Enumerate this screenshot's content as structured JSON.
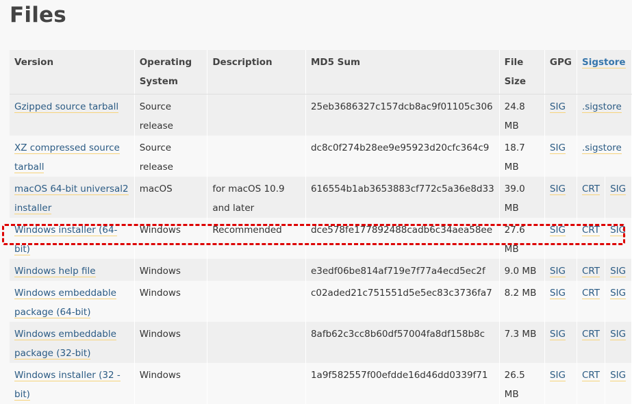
{
  "page": {
    "title": "Files"
  },
  "table": {
    "headers": {
      "version": "Version",
      "os": "Operating System",
      "description": "Description",
      "md5": "MD5 Sum",
      "size": "File Size",
      "gpg": "GPG",
      "sigstore": "Sigstore"
    },
    "rows": [
      {
        "version": "Gzipped source tarball",
        "os": "Source release",
        "description": "",
        "md5": "25eb3686327c157dcb8ac9f01105c306",
        "size": "24.8 MB",
        "gpg": "SIG",
        "sigstore": ".sigstore",
        "sig2": ""
      },
      {
        "version": "XZ compressed source tarball",
        "os": "Source release",
        "description": "",
        "md5": "dc8c0f274b28ee9e95923d20cfc364c9",
        "size": "18.7 MB",
        "gpg": "SIG",
        "sigstore": ".sigstore",
        "sig2": ""
      },
      {
        "version": "macOS 64-bit universal2 installer",
        "os": "macOS",
        "description": "for macOS 10.9 and later",
        "md5": "616554b1ab3653883cf772c5a36e8d33",
        "size": "39.0 MB",
        "gpg": "SIG",
        "sigstore": "CRT",
        "sig2": "SIG"
      },
      {
        "version": "Windows installer (64-bit)",
        "os": "Windows",
        "description": "Recommended",
        "md5": "dce578fe177892488cadb6c34aea58ee",
        "size": "27.6 MB",
        "gpg": "SIG",
        "sigstore": "CRT",
        "sig2": "SIG"
      },
      {
        "version": "Windows help file",
        "os": "Windows",
        "description": "",
        "md5": "e3edf06be814af719e7f77a4ecd5ec2f",
        "size": "9.0 MB",
        "gpg": "SIG",
        "sigstore": "CRT",
        "sig2": "SIG"
      },
      {
        "version": "Windows embeddable package (64-bit)",
        "os": "Windows",
        "description": "",
        "md5": "c02aded21c751551d5e5ec83c3736fa7",
        "size": "8.2 MB",
        "gpg": "SIG",
        "sigstore": "CRT",
        "sig2": "SIG"
      },
      {
        "version": "Windows embeddable package (32-bit)",
        "os": "Windows",
        "description": "",
        "md5": "8afb62c3cc8b60df57004fa8df158b8c",
        "size": "7.3 MB",
        "gpg": "SIG",
        "sigstore": "CRT",
        "sig2": "SIG"
      },
      {
        "version": "Windows installer (32 -bit)",
        "os": "Windows",
        "description": "",
        "md5": "1a9f582557f00efdde16d46dd0339f71",
        "size": "26.5 MB",
        "gpg": "SIG",
        "sigstore": "CRT",
        "sig2": "SIG"
      }
    ]
  },
  "colors": {
    "link": "#2b5b84",
    "link_underline": "#f6d37a",
    "highlight": "#dd0000",
    "row_alt": "#efefef"
  }
}
